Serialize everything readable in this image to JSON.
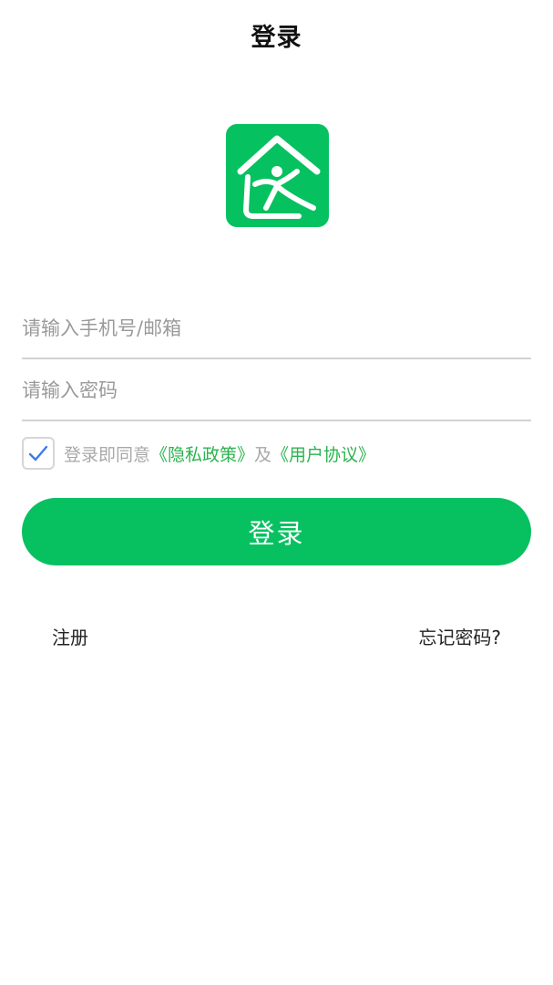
{
  "header": {
    "title": "登录"
  },
  "logo": {
    "icon": "house-person-logo-icon",
    "color": "#06c160"
  },
  "form": {
    "phone_placeholder": "请输入手机号/邮箱",
    "phone_value": "",
    "password_placeholder": "请输入密码",
    "password_value": ""
  },
  "agreement": {
    "checked": true,
    "prefix": "登录即同意",
    "privacy_link": "《隐私政策》",
    "conjunction": "及",
    "terms_link": "《用户协议》",
    "check_color": "#3a7bea",
    "link_color": "#2bb34e"
  },
  "actions": {
    "login_label": "登录",
    "register_label": "注册",
    "forgot_label": "忘记密码?"
  },
  "colors": {
    "accent": "#07c160"
  }
}
